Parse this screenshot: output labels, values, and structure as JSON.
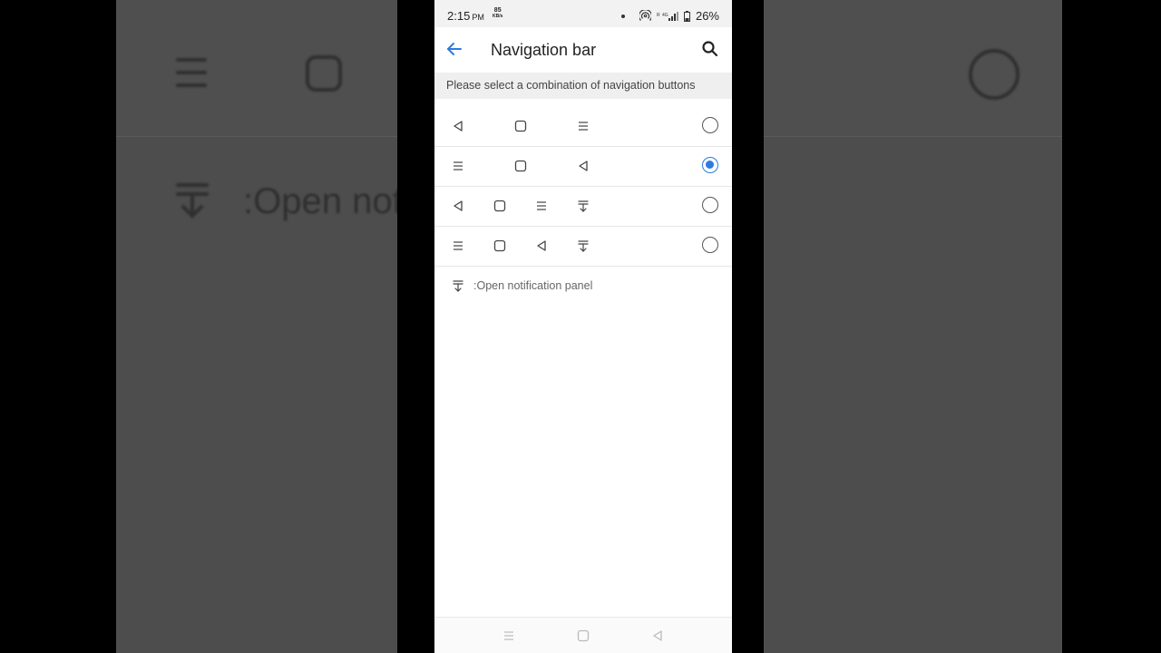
{
  "status_bar": {
    "time": "2:15",
    "ampm": "PM",
    "speed_value": "85",
    "speed_unit": "KB/s",
    "battery": "26%"
  },
  "app_bar": {
    "title": "Navigation bar",
    "back_icon": "back-arrow-icon",
    "search_icon": "search-icon"
  },
  "subheader": "Please select a combination of navigation buttons",
  "options": [
    {
      "buttons": [
        "back",
        "home",
        "recents"
      ],
      "selected": false
    },
    {
      "buttons": [
        "recents",
        "home",
        "back"
      ],
      "selected": true
    },
    {
      "buttons": [
        "back",
        "home",
        "recents",
        "notification"
      ],
      "selected": false
    },
    {
      "buttons": [
        "recents",
        "home",
        "back",
        "notification"
      ],
      "selected": false
    }
  ],
  "note": {
    "icon": "notification-panel-icon",
    "text": ":Open notification panel"
  },
  "background": {
    "text": ":Open not"
  },
  "accent_color": "#2d7be0"
}
